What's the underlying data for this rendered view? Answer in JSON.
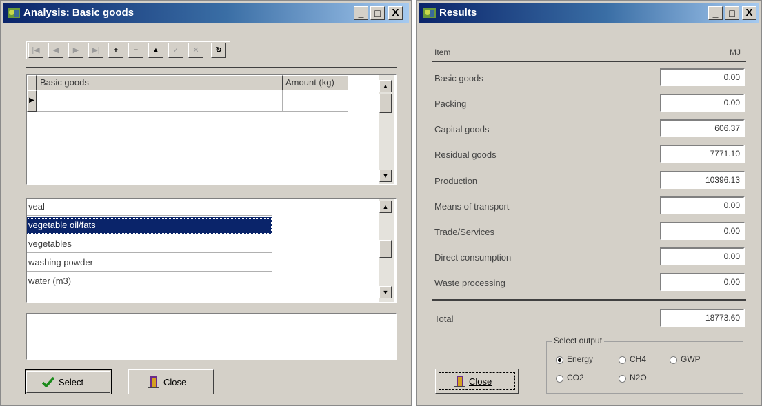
{
  "analysis_window": {
    "title": "Analysis: Basic goods",
    "title_buttons": [
      "_",
      "□",
      "X"
    ],
    "navigator": [
      "|◀",
      "◀",
      "▶",
      "▶|",
      "+",
      "−",
      "▲",
      "✓",
      "✕",
      "↻"
    ],
    "grid": {
      "columns": [
        "Basic goods",
        "Amount (kg)"
      ],
      "rows": [
        [
          "",
          ""
        ]
      ],
      "current_row_marker": "▶"
    },
    "list_items": [
      "veal",
      "vegetable oil/fats",
      "vegetables",
      "washing powder",
      "water (m3)"
    ],
    "selected_item": "vegetable oil/fats",
    "notes": "",
    "select_button": "Select",
    "close_button": "Close"
  },
  "results_window": {
    "title": "Results",
    "title_buttons": [
      "_",
      "□",
      "X"
    ],
    "header": {
      "item": "Item",
      "unit": "MJ"
    },
    "rows": [
      {
        "label": "Basic goods",
        "value": "0.00"
      },
      {
        "label": "Packing",
        "value": "0.00"
      },
      {
        "label": "Capital goods",
        "value": "606.37"
      },
      {
        "label": "Residual goods",
        "value": "7771.10"
      },
      {
        "label": "Production",
        "value": "10396.13"
      },
      {
        "label": "Means of transport",
        "value": "0.00"
      },
      {
        "label": "Trade/Services",
        "value": "0.00"
      },
      {
        "label": "Direct consumption",
        "value": "0.00"
      },
      {
        "label": "Waste processing",
        "value": "0.00"
      }
    ],
    "total": {
      "label": "Total",
      "value": "18773.60"
    },
    "select_output": {
      "legend": "Select output",
      "options": [
        "Energy",
        "CH4",
        "GWP",
        "CO2",
        "N2O"
      ],
      "selected": "Energy"
    },
    "close_button": "Close"
  },
  "colors": {
    "titlebar_start": "#0a246a",
    "titlebar_end": "#a6caf0",
    "selection": "#0a246a",
    "face": "#d4d0c8"
  }
}
